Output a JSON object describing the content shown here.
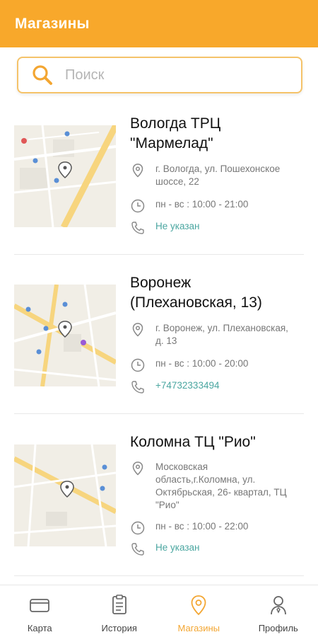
{
  "header": {
    "title": "Магазины"
  },
  "search": {
    "placeholder": "Поиск",
    "value": ""
  },
  "stores": [
    {
      "name_line1": "Вологда ТРЦ",
      "name_line2": "\"Мармелад\"",
      "address_line1": "г. Вологда, ул. Пошехонское",
      "address_line2": "шоссе, 22",
      "hours": "пн - вс : 10:00 - 21:00",
      "phone": "Не указан"
    },
    {
      "name_line1": "Воронеж",
      "name_line2": "(Плехановская, 13)",
      "address_line1": "г. Воронеж, ул. Плехановская,",
      "address_line2": "д. 13",
      "hours": "пн - вс : 10:00 - 20:00",
      "phone": "+74732333494"
    },
    {
      "name_line1": "Коломна ТЦ \"Рио\"",
      "address_line1": "Московская",
      "address_line2": "область,г.Коломна, ул.",
      "address_line3": "Октябрьская, 26- квартал, ТЦ",
      "address_line4": "\"Рио\"",
      "hours": "пн - вс : 10:00 - 22:00",
      "phone": "Не указан"
    }
  ],
  "nav": {
    "items": [
      {
        "label": "Карта",
        "icon": "card-icon"
      },
      {
        "label": "История",
        "icon": "history-icon"
      },
      {
        "label": "Магазины",
        "icon": "stores-icon",
        "active": true
      },
      {
        "label": "Профиль",
        "icon": "profile-icon"
      }
    ]
  },
  "colors": {
    "accent": "#f8a82b",
    "phone_link": "#4aa6a0",
    "active_nav": "#f3a632"
  }
}
